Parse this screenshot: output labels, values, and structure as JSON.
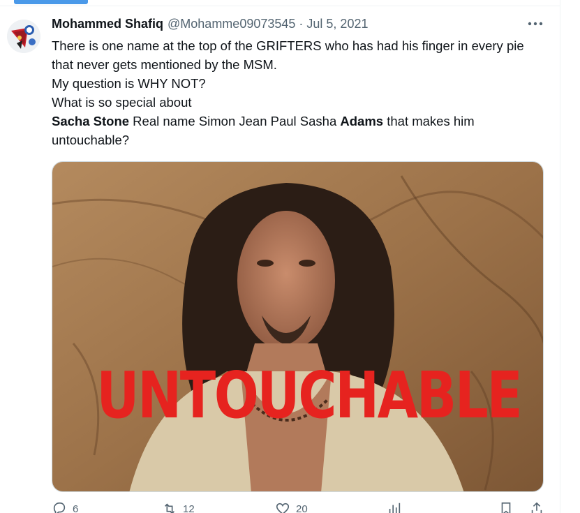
{
  "tweet": {
    "author_name": "Mohammed Shafiq",
    "handle": "@Mohamme09073545",
    "separator": "·",
    "date": "Jul 5, 2021",
    "text": {
      "line1": "There is one name at the top of the GRIFTERS who has had his finger in every pie that never gets mentioned by the MSM.",
      "line2": "My question is WHY NOT?",
      "line3": "What is so special about",
      "line4_bold1": "Sacha Stone",
      "line4_mid": " Real name Simon Jean Paul Sasha ",
      "line4_bold2": "Adams",
      "line4_end": " that makes him untouchable?"
    },
    "media": {
      "overlay_text": "UNTOUCHABLE",
      "overlay_color": "#e6231f"
    }
  },
  "actions": {
    "reply_count": "6",
    "retweet_count": "12",
    "like_count": "20"
  },
  "icons": {
    "more": "more-horizontal-icon",
    "reply": "reply-icon",
    "retweet": "retweet-icon",
    "like": "heart-icon",
    "views": "views-icon",
    "bookmark": "bookmark-icon",
    "share": "share-icon"
  },
  "colors": {
    "accent": "#4a99e9",
    "text": "#0f1419",
    "secondary": "#536471"
  }
}
